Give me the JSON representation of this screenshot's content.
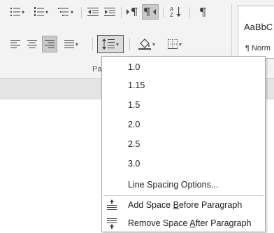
{
  "ribbon": {
    "group_label": "Pa",
    "styles": {
      "sample": "AaBbC",
      "normal_label": "¶ Norm"
    }
  },
  "line_spacing_menu": {
    "spacing_options": [
      {
        "label": "1.0"
      },
      {
        "label": "1.15"
      },
      {
        "label": "1.5"
      },
      {
        "label": "2.0"
      },
      {
        "label": "2.5"
      },
      {
        "label": "3.0"
      }
    ],
    "options_label": "Line Spacing Options...",
    "add_before": {
      "pre": "Add Space ",
      "key": "B",
      "post": "efore Paragraph"
    },
    "remove_after": {
      "pre": "Remove Space ",
      "key": "A",
      "post": "fter Paragraph"
    }
  },
  "icons": {
    "row1": [
      "bullets-icon",
      "numbering-icon",
      "multilevel-list-icon",
      "decrease-indent-icon",
      "increase-indent-icon",
      "ltr-paragraph-icon",
      "rtl-paragraph-icon",
      "sort-icon",
      "show-formatting-marks-icon"
    ],
    "row2": [
      "align-left-icon",
      "align-center-icon",
      "align-right-icon",
      "justify-icon",
      "line-spacing-icon",
      "shading-icon",
      "borders-icon"
    ]
  }
}
